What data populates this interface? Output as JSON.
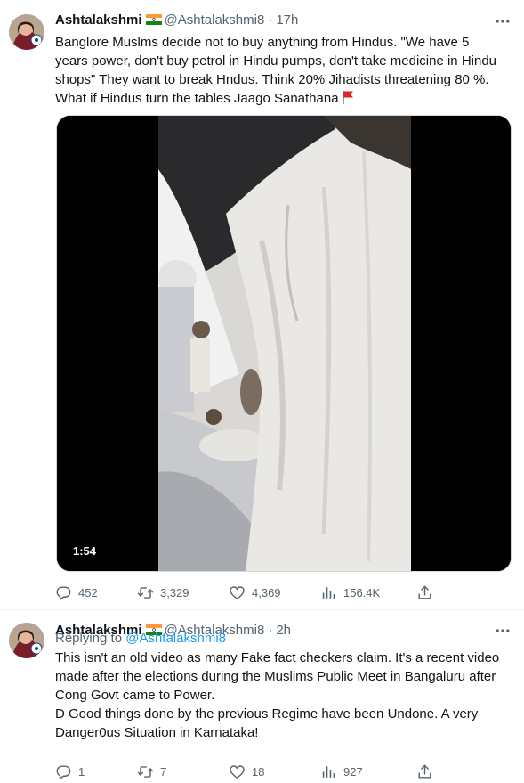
{
  "tweets": [
    {
      "author": {
        "name": "Ashtalakshmi",
        "flag_icon": "india-flag-icon",
        "handle": "@Ashtalakshmi8",
        "separator": "·",
        "time": "17h"
      },
      "text_lines": [
        "Banglore Muslms decide not to buy anything from Hindus. \"We have 5",
        "years power, don't buy petrol in Hindu pumps, don't take medicine in Hindu",
        "shops\"  They  want to break Hndus. Think  20% Jihadists threatening 80 %.",
        "What if Hindus  turn the tables  Jaago Sanathana"
      ],
      "emoji_icon": "red-triangular-flag-icon",
      "media": {
        "type": "video",
        "duration": "1:54"
      },
      "stats": {
        "replies": "452",
        "retweets": "3,329",
        "likes": "4,369",
        "views": "156.4K"
      }
    },
    {
      "author": {
        "name": "Ashtalakshmi",
        "flag_icon": "india-flag-icon",
        "handle": "@Ashtalakshmi8",
        "separator": "·",
        "time": "2h"
      },
      "replying_prefix": "Replying to",
      "replying_to": "@Ashtalakshmi8",
      "text_lines": [
        "This isn't an old video as many Fake fact checkers claim. It's a recent video",
        "made after the elections during the Muslims Public Meet in Bangaluru after",
        "Cong Govt came to Power.",
        "D Good things done by the previous Regime have been Undone. A very",
        "Danger0us Situation in Karnataka!"
      ],
      "stats": {
        "replies": "1",
        "retweets": "7",
        "likes": "18",
        "views": "927"
      }
    }
  ],
  "colors": {
    "text": "#0f1419",
    "secondary": "#536471",
    "link": "#1d9bf0",
    "divider": "#eff3f4"
  }
}
